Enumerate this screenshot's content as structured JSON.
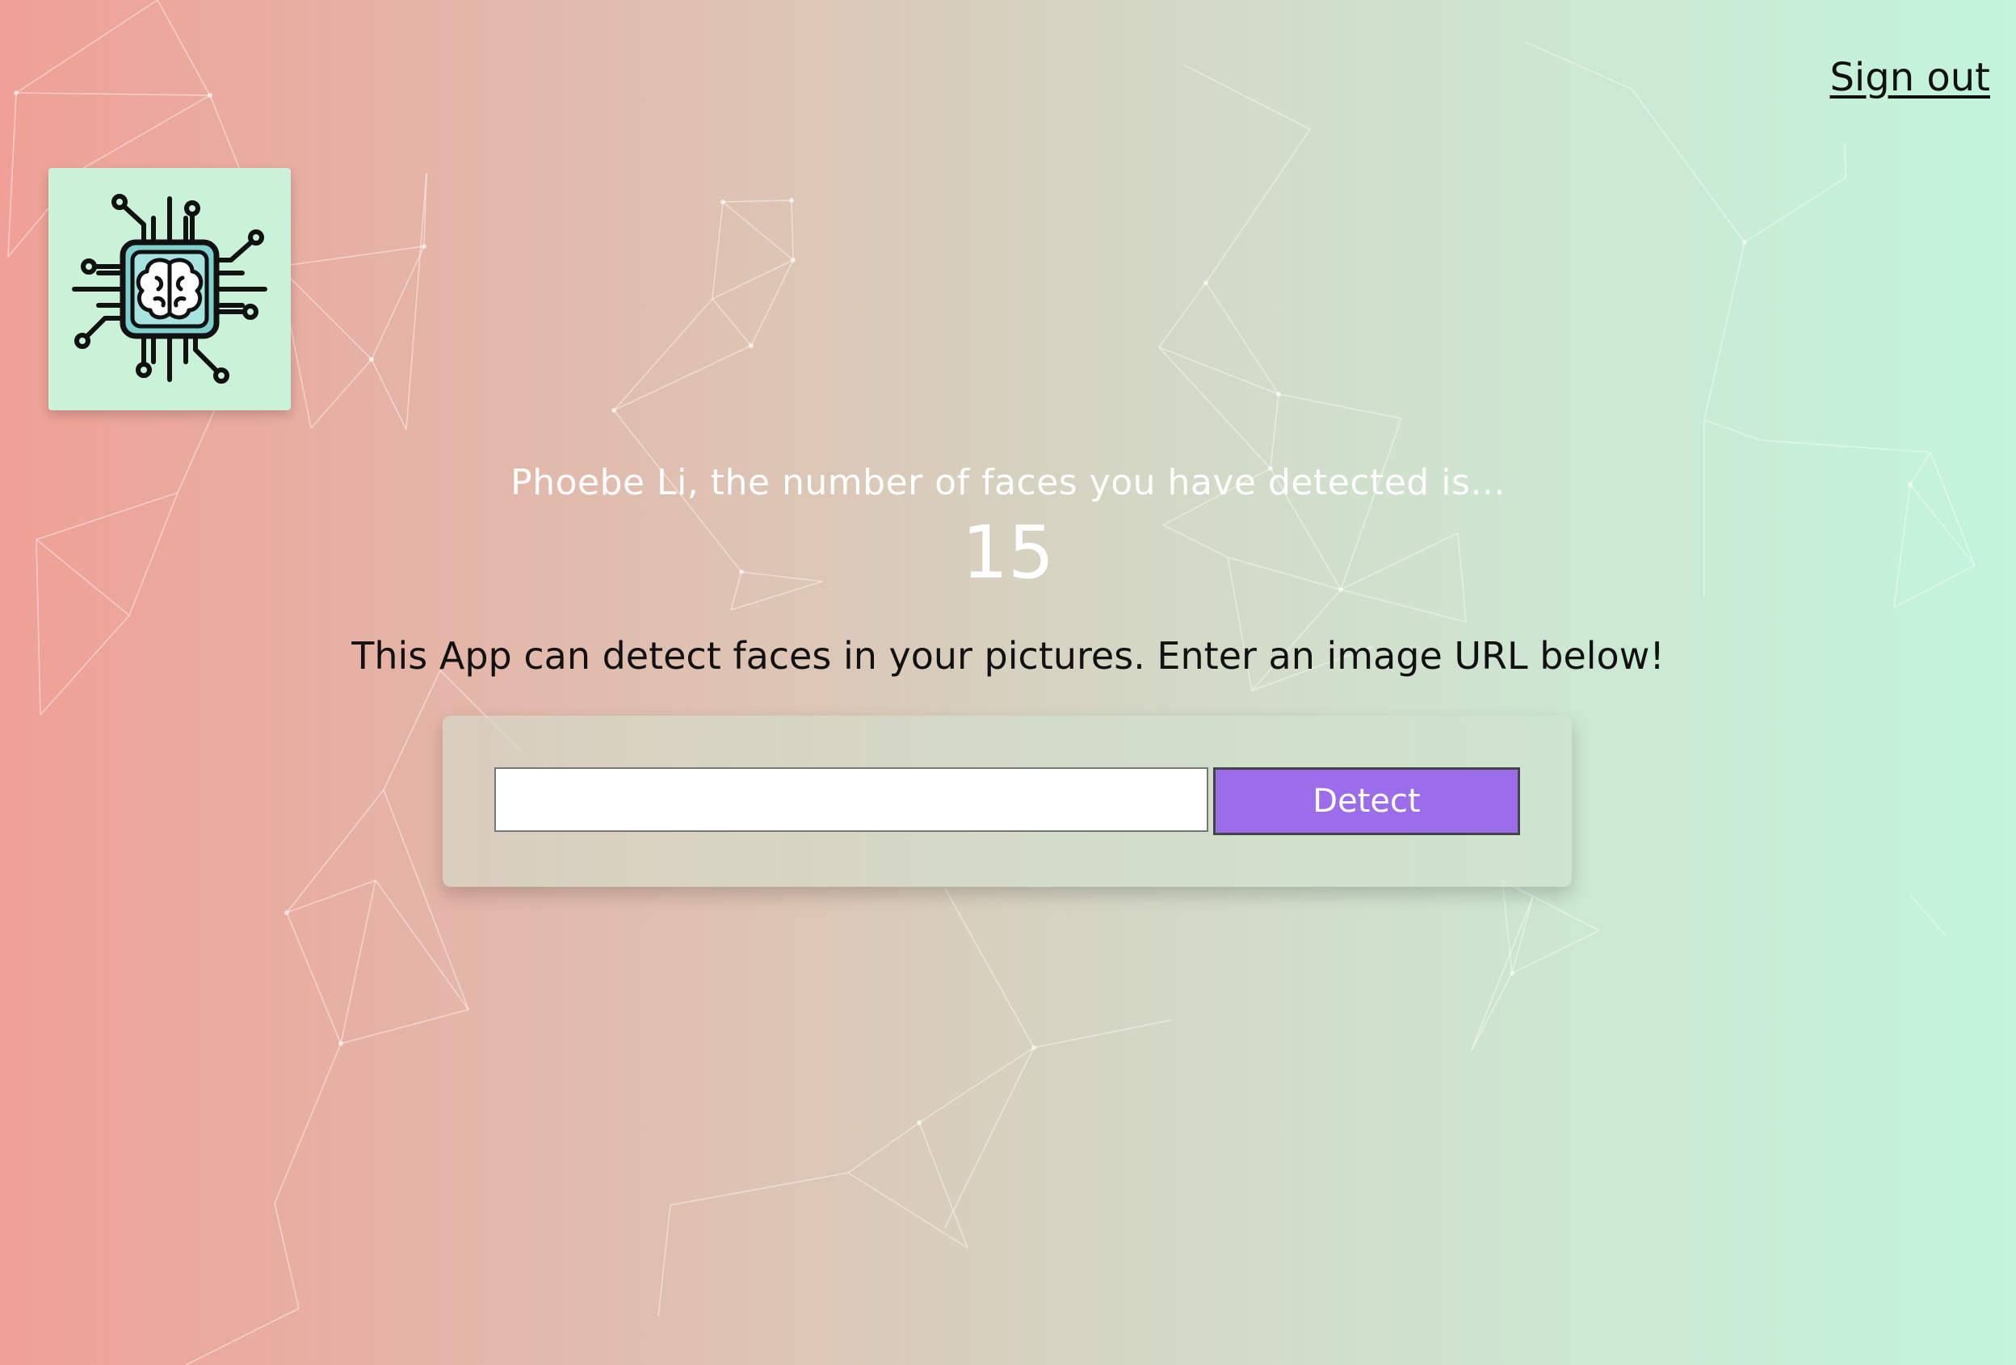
{
  "header": {
    "signout_label": "Sign out"
  },
  "logo": {
    "icon": "brain-chip-icon",
    "background": "#c9f2d9"
  },
  "rank": {
    "message": "Phoebe Li, the number of faces you have detected is...",
    "count": "15"
  },
  "intro": {
    "text": "This App can detect faces in your pictures. Enter an image URL below!"
  },
  "form": {
    "input_value": "",
    "input_placeholder": "",
    "button_label": "Detect"
  },
  "colors": {
    "gradient_left": "#f0a096",
    "gradient_right": "#c2f5dc",
    "button": "#9b6dea"
  }
}
